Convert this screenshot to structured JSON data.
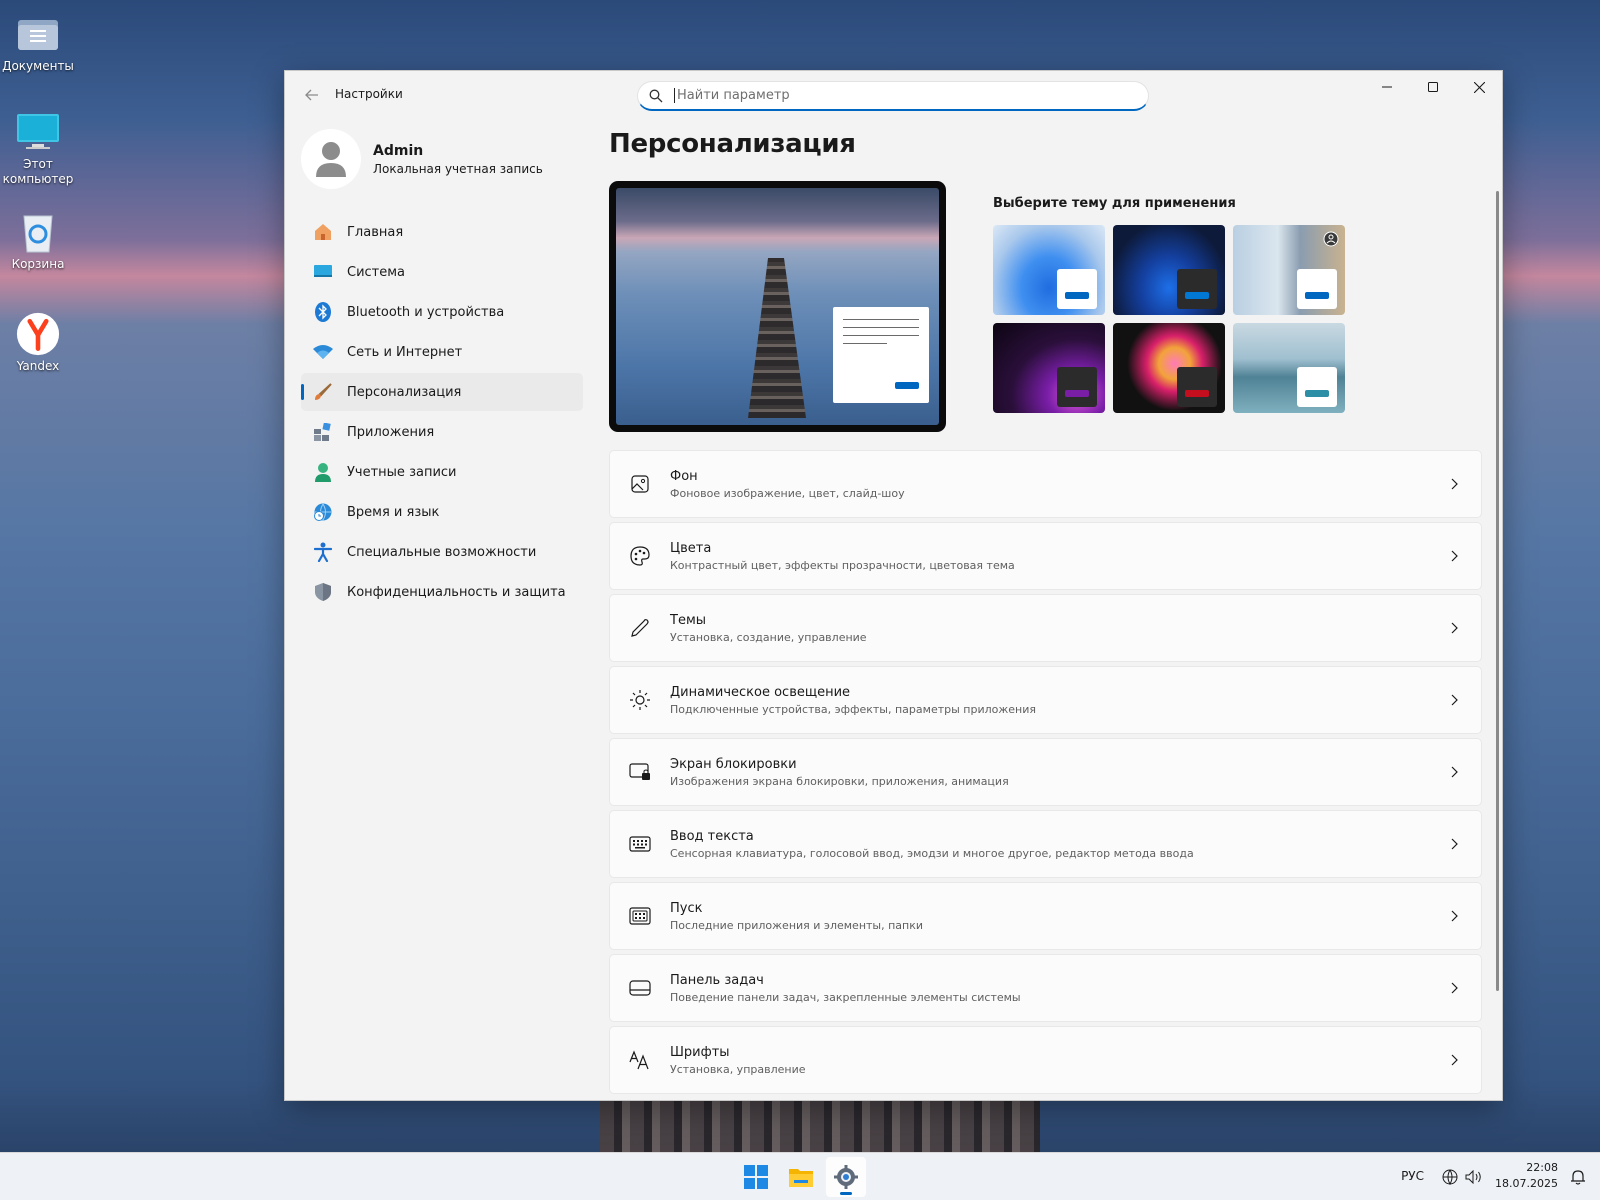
{
  "desktop": {
    "icons": [
      {
        "label": "Документы",
        "icon": "folder-icon"
      },
      {
        "label": "Этот компьютер",
        "icon": "monitor-icon"
      },
      {
        "label": "Корзина",
        "icon": "recycle-bin-icon"
      },
      {
        "label": "Yandex",
        "icon": "yandex-icon"
      }
    ]
  },
  "window": {
    "app_title": "Настройки",
    "search_placeholder": "Найти параметр",
    "profile": {
      "name": "Admin",
      "subtitle": "Локальная учетная запись"
    },
    "nav": [
      {
        "label": "Главная",
        "icon": "home-icon"
      },
      {
        "label": "Система",
        "icon": "system-icon"
      },
      {
        "label": "Bluetooth и устройства",
        "icon": "bluetooth-icon"
      },
      {
        "label": "Сеть и Интернет",
        "icon": "wifi-icon"
      },
      {
        "label": "Персонализация",
        "icon": "brush-icon",
        "active": true
      },
      {
        "label": "Приложения",
        "icon": "apps-icon"
      },
      {
        "label": "Учетные записи",
        "icon": "account-icon"
      },
      {
        "label": "Время и язык",
        "icon": "globe-clock-icon"
      },
      {
        "label": "Специальные возможности",
        "icon": "accessibility-icon"
      },
      {
        "label": "Конфиденциальность и защита",
        "icon": "shield-icon"
      }
    ],
    "page_title": "Персонализация",
    "theme_heading": "Выберите тему для применения",
    "themes": [
      {
        "bg": "#a9c8ec",
        "accent": "#0067c0",
        "mini_bg": "#ffffff"
      },
      {
        "bg": "#0d1a3a",
        "accent": "#0078d4",
        "mini_bg": "#2b2b2b"
      },
      {
        "bg": "#c6d8e8",
        "accent": "#0067c0",
        "mini_bg": "#ffffff"
      },
      {
        "bg": "#2a0f3a",
        "accent": "#7a1ea8",
        "mini_bg": "#2b2b2b"
      },
      {
        "bg": "#111111",
        "accent": "#c50f1f",
        "mini_bg": "#2b2b2b"
      },
      {
        "bg": "#8fb3c3",
        "accent": "#2d8fa6",
        "mini_bg": "#ffffff"
      }
    ],
    "rows": [
      {
        "title": "Фон",
        "subtitle": "Фоновое изображение, цвет, слайд-шоу",
        "icon": "image-icon"
      },
      {
        "title": "Цвета",
        "subtitle": "Контрастный цвет, эффекты прозрачности, цветовая тема",
        "icon": "palette-icon"
      },
      {
        "title": "Темы",
        "subtitle": "Установка, создание, управление",
        "icon": "pen-icon"
      },
      {
        "title": "Динамическое освещение",
        "subtitle": "Подключенные устройства, эффекты, параметры приложения",
        "icon": "lighting-icon"
      },
      {
        "title": "Экран блокировки",
        "subtitle": "Изображения экрана блокировки, приложения, анимация",
        "icon": "lock-screen-icon"
      },
      {
        "title": "Ввод текста",
        "subtitle": "Сенсорная клавиатура, голосовой ввод, эмодзи и многое другое, редактор метода ввода",
        "icon": "keyboard-icon"
      },
      {
        "title": "Пуск",
        "subtitle": "Последние приложения и элементы, папки",
        "icon": "start-icon"
      },
      {
        "title": "Панель задач",
        "subtitle": "Поведение панели задач, закрепленные элементы системы",
        "icon": "taskbar-icon"
      },
      {
        "title": "Шрифты",
        "subtitle": "Установка, управление",
        "icon": "fonts-icon"
      }
    ]
  },
  "taskbar": {
    "apps": [
      {
        "icon": "windows-start-icon"
      },
      {
        "icon": "file-explorer-icon"
      },
      {
        "icon": "settings-gear-icon",
        "active": true
      }
    ],
    "language": "РУС",
    "time": "22:08",
    "date": "18.07.2025"
  }
}
